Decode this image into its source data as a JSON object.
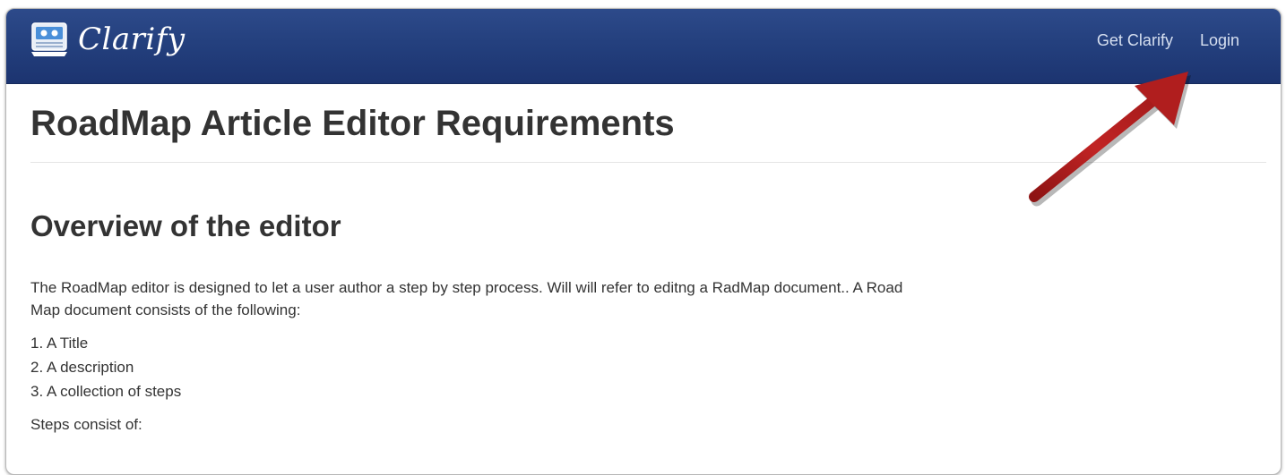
{
  "navbar": {
    "brand_name": "Clarify",
    "links": [
      {
        "label": "Get Clarify"
      },
      {
        "label": "Login"
      }
    ]
  },
  "main": {
    "title": "RoadMap Article Editor Requirements",
    "section_title": "Overview of the editor",
    "paragraph": "The RoadMap editor is designed to let a user author a step by step process. Will will refer to editng a RadMap document.. A Road Map document consists of the following:",
    "list_items": [
      "1. A Title",
      "2. A description",
      "3. A collection of steps"
    ],
    "steps_label": "Steps consist of:"
  },
  "annotation": {
    "arrow_color": "#b01e1e",
    "points_to": "Login"
  },
  "icons": {
    "brand_logo": "clarify-logo-icon"
  }
}
